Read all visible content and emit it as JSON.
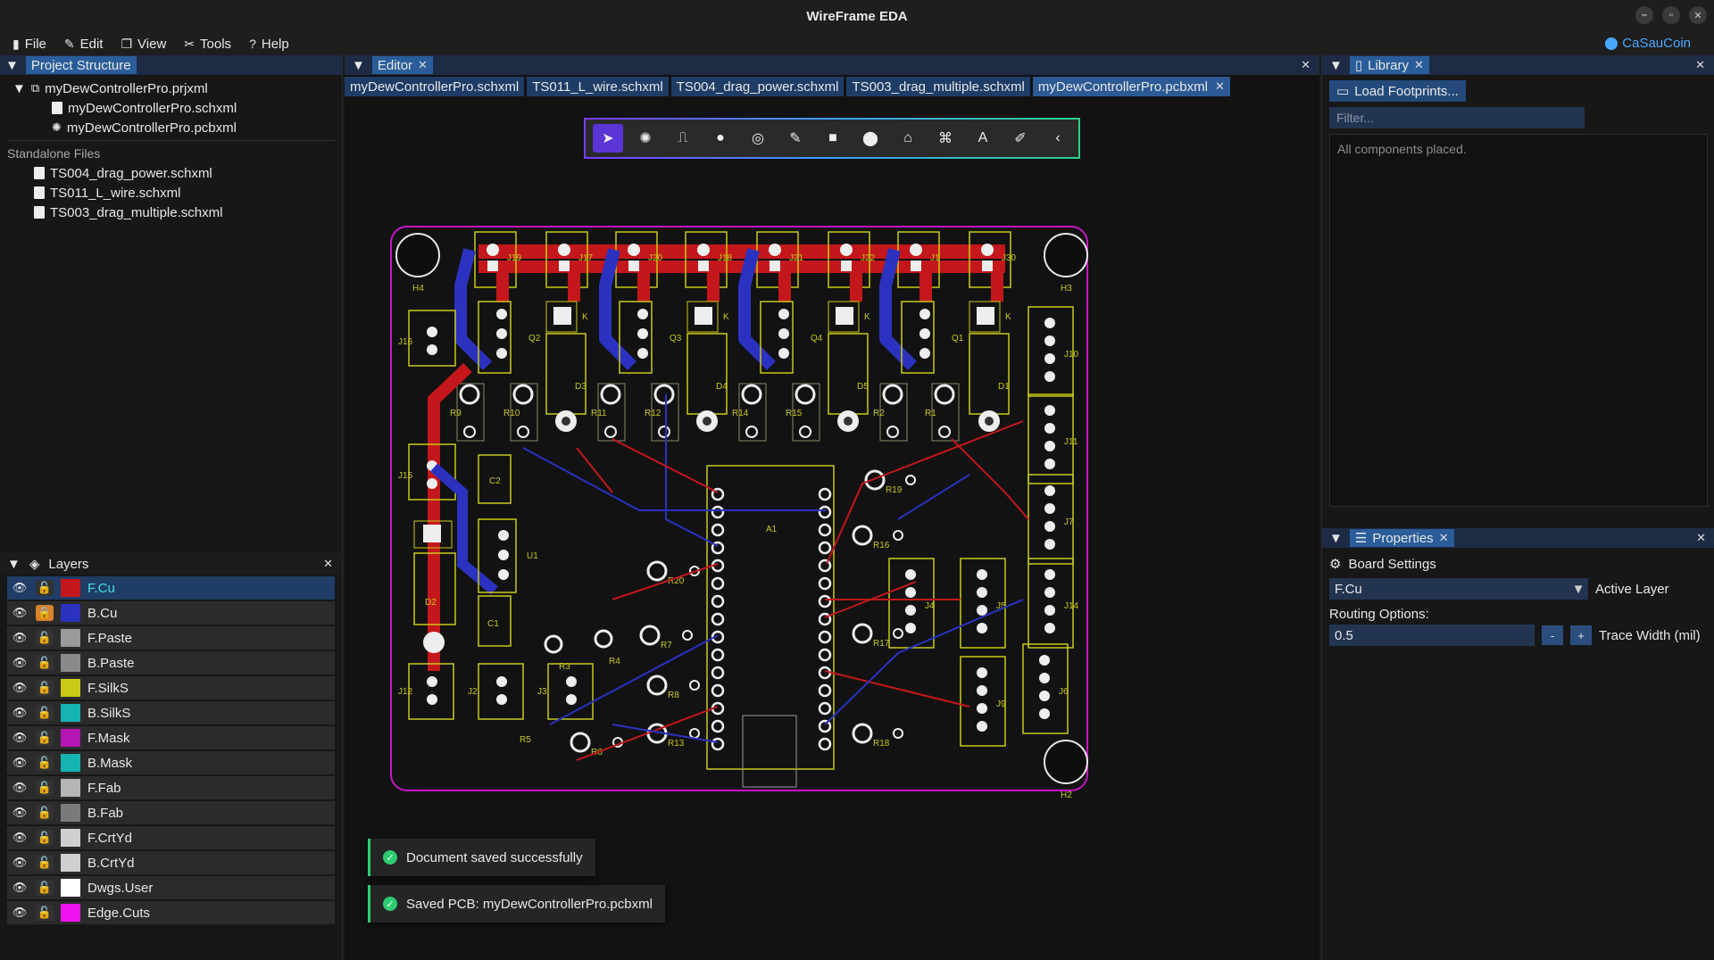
{
  "app": {
    "title": "WireFrame EDA"
  },
  "menu": [
    {
      "label": "File",
      "icon": "file-icon"
    },
    {
      "label": "Edit",
      "icon": "edit-icon"
    },
    {
      "label": "View",
      "icon": "view-icon"
    },
    {
      "label": "Tools",
      "icon": "tools-icon"
    },
    {
      "label": "Help",
      "icon": "help-icon"
    }
  ],
  "user": {
    "name": "CaSauCoin"
  },
  "project": {
    "header": "Project Structure",
    "items": [
      {
        "label": "myDewControllerPro.prjxml",
        "level": 0
      },
      {
        "label": "myDewControllerPro.schxml",
        "level": 1
      },
      {
        "label": "myDewControllerPro.pcbxml",
        "level": 1
      }
    ],
    "standalone_label": "Standalone Files",
    "standalone": [
      "TS004_drag_power.schxml",
      "TS011_L_wire.schxml",
      "TS003_drag_multiple.schxml"
    ]
  },
  "layers": {
    "header": "Layers",
    "items": [
      {
        "name": "F.Cu",
        "color": "#c4171b",
        "active": true,
        "locked": false
      },
      {
        "name": "B.Cu",
        "color": "#2b32c0",
        "active": false,
        "locked": true
      },
      {
        "name": "F.Paste",
        "color": "#9a9a9a",
        "active": false,
        "locked": false
      },
      {
        "name": "B.Paste",
        "color": "#8a8a8a",
        "active": false,
        "locked": false
      },
      {
        "name": "F.SilkS",
        "color": "#c9c916",
        "active": false,
        "locked": false
      },
      {
        "name": "B.SilkS",
        "color": "#16b3b3",
        "active": false,
        "locked": false
      },
      {
        "name": "F.Mask",
        "color": "#b316b3",
        "active": false,
        "locked": false
      },
      {
        "name": "B.Mask",
        "color": "#16b3b3",
        "active": false,
        "locked": false
      },
      {
        "name": "F.Fab",
        "color": "#b5b5b5",
        "active": false,
        "locked": false
      },
      {
        "name": "B.Fab",
        "color": "#7a7a7a",
        "active": false,
        "locked": false
      },
      {
        "name": "F.CrtYd",
        "color": "#cfcfcf",
        "active": false,
        "locked": false
      },
      {
        "name": "B.CrtYd",
        "color": "#cfcfcf",
        "active": false,
        "locked": false
      },
      {
        "name": "Dwgs.User",
        "color": "#ffffff",
        "active": false,
        "locked": false
      },
      {
        "name": "Edge.Cuts",
        "color": "#ee12ee",
        "active": false,
        "locked": false
      }
    ]
  },
  "editor": {
    "header": "Editor",
    "tabs": [
      {
        "label": "myDewControllerPro.schxml",
        "active": false
      },
      {
        "label": "TS011_L_wire.schxml",
        "active": false
      },
      {
        "label": "TS004_drag_power.schxml",
        "active": false
      },
      {
        "label": "TS003_drag_multiple.schxml",
        "active": false
      },
      {
        "label": "myDewControllerPro.pcbxml",
        "active": true
      }
    ],
    "tools": [
      "select-tool-icon",
      "component-tool-icon",
      "wire-tool-icon",
      "pad-tool-icon",
      "via-tool-icon",
      "draw-tool-icon",
      "rectangle-tool-icon",
      "circle-tool-icon",
      "arc-tool-icon",
      "polygon-tool-icon",
      "text-tool-icon",
      "measure-tool-icon",
      "collapse-icon"
    ]
  },
  "board": {
    "components": {
      "connectors_top": [
        "J19",
        "J17",
        "J20",
        "J18",
        "J21",
        "J22",
        "J1",
        "J30"
      ],
      "transistors": [
        "Q2",
        "Q3",
        "Q4",
        "Q1"
      ],
      "diodes": [
        "D3",
        "D4",
        "D5",
        "D1"
      ],
      "diode_pin_label": "K",
      "resistors_row": [
        "R9",
        "R10",
        "R11",
        "R12",
        "R14",
        "R15",
        "R2",
        "R1"
      ],
      "mounting_holes": [
        "H4",
        "H3",
        "H2"
      ],
      "other": [
        "J16",
        "J15",
        "C2",
        "U1",
        "D2",
        "C1",
        "R3",
        "R4",
        "R20",
        "R7",
        "R8",
        "R13",
        "R5",
        "R6",
        "A1",
        "R19",
        "R16",
        "R17",
        "R18",
        "J6",
        "J4",
        "J5",
        "J9",
        "J10",
        "J11",
        "J7",
        "J14",
        "J12",
        "J2",
        "J3"
      ]
    }
  },
  "toasts": [
    "Document saved successfully",
    "Saved PCB: myDewControllerPro.pcbxml"
  ],
  "library": {
    "header": "Library",
    "load_button": "Load Footprints...",
    "filter_placeholder": "Filter...",
    "empty_text": "All components placed."
  },
  "properties": {
    "header": "Properties",
    "section": "Board Settings",
    "active_layer_value": "F.Cu",
    "active_layer_label": "Active Layer",
    "routing_label": "Routing Options:",
    "trace_width_value": "0.5",
    "trace_width_label": "Trace Width (mil)",
    "minus": "-",
    "plus": "+"
  }
}
